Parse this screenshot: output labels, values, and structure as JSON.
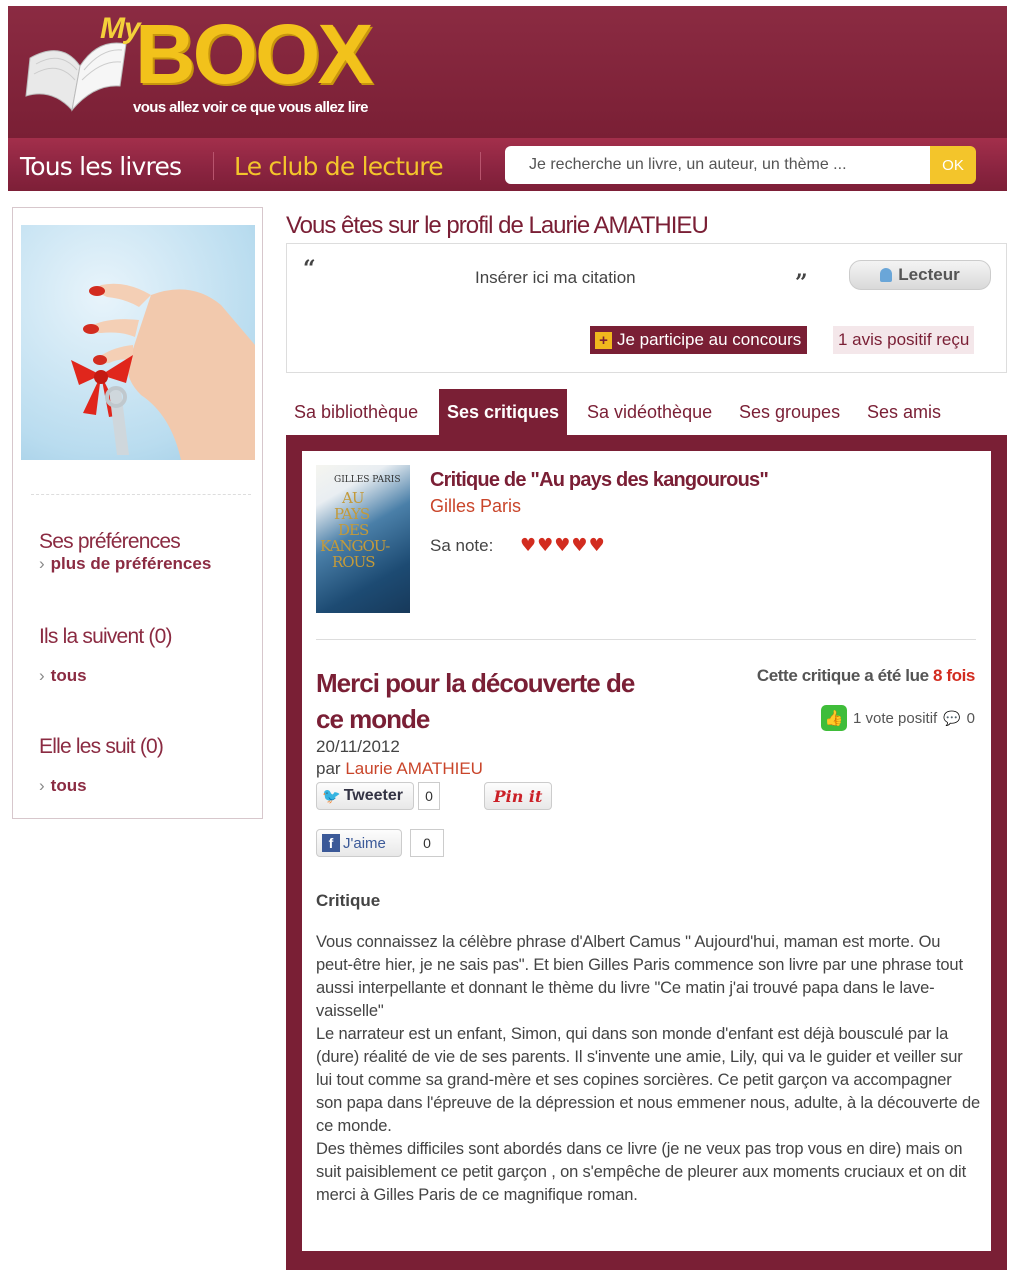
{
  "header": {
    "logo_my": "My",
    "logo_boox": "BOOX",
    "tagline": "vous allez voir ce que vous allez lire"
  },
  "nav": {
    "all_books": "Tous les livres",
    "reading_club": "Le club de lecture",
    "search_placeholder": "Je recherche un livre, un auteur, un thème ...",
    "search_button": "OK"
  },
  "sidebar": {
    "preferences_title": "Ses préférences",
    "preferences_link": "plus de préférences",
    "followers_title": "Ils la suivent (0)",
    "followers_link": "tous",
    "following_title": "Elle les suit (0)",
    "following_link": "tous"
  },
  "profile": {
    "title": "Vous êtes sur le profil de Laurie AMATHIEU",
    "quote_open": "“",
    "quote_close": "”",
    "quote_placeholder": "Insérer ici ma citation",
    "role_button": "Lecteur",
    "contest_button": "Je participe au concours",
    "positive_reviews": "1 avis positif reçu"
  },
  "tabs": [
    {
      "label": "Sa bibliothèque",
      "active": false
    },
    {
      "label": "Ses critiques",
      "active": true
    },
    {
      "label": "Sa vidéothèque",
      "active": false
    },
    {
      "label": "Ses groupes",
      "active": false
    },
    {
      "label": "Ses amis",
      "active": false
    }
  ],
  "book": {
    "cover_author": "GILLES PARIS",
    "cover_title_lines": [
      "AU",
      "PAYS",
      "DES",
      "KANGOU-",
      "ROUS"
    ],
    "critique_title": "Critique de \"Au pays des kangourous\"",
    "author": "Gilles Paris",
    "note_label": "Sa note:",
    "rating": 5,
    "heart_glyph": "♥"
  },
  "review": {
    "title": "Merci pour la découverte de ce monde",
    "read_prefix": "Cette critique a été lue",
    "read_count": "8 fois",
    "positive_votes": "1 vote positif",
    "comments": "0",
    "date": "20/11/2012",
    "by_prefix": "par",
    "by_author": "Laurie AMATHIEU",
    "tweet_label": "Tweeter",
    "tweet_count": "0",
    "pin_label": "Pin it",
    "like_label": "J'aime",
    "like_count": "0",
    "section_heading": "Critique",
    "body": [
      "Vous connaissez la célèbre phrase d'Albert Camus \" Aujourd'hui, maman est morte. Ou peut-être hier, je ne sais pas\". Et bien Gilles Paris commence son livre par une phrase tout aussi interpellante et donnant le thème du livre \"Ce matin j'ai trouvé papa dans le lave-vaisselle\"",
      "Le narrateur est un enfant, Simon, qui dans son monde d'enfant est déjà bousculé par la (dure) réalité de vie de ses parents. Il s'invente une amie, Lily, qui va le guider et veiller sur lui tout comme sa grand-mère et ses copines sorcières. Ce petit garçon va accompagner son papa dans l'épreuve de la dépression et nous emmener nous, adulte, à la découverte de ce monde.",
      "Des thèmes difficiles sont abordés dans ce livre (je ne veux pas trop vous en dire) mais on suit paisiblement ce petit garçon , on s'empêche de pleurer aux moments cruciaux et on dit merci à Gilles Paris de ce magnifique roman."
    ]
  },
  "colors": {
    "brand": "#7a1f35",
    "accent_yellow": "#f3c52b",
    "link_orange": "#c9452a",
    "heart_red": "#d22c1f"
  },
  "icons": [
    "book-logo-icon",
    "user-icon",
    "plus-icon",
    "heart-icon",
    "thumb-up-icon",
    "comment-icon",
    "twitter-bird-icon",
    "facebook-icon",
    "arrow-right-icon"
  ]
}
